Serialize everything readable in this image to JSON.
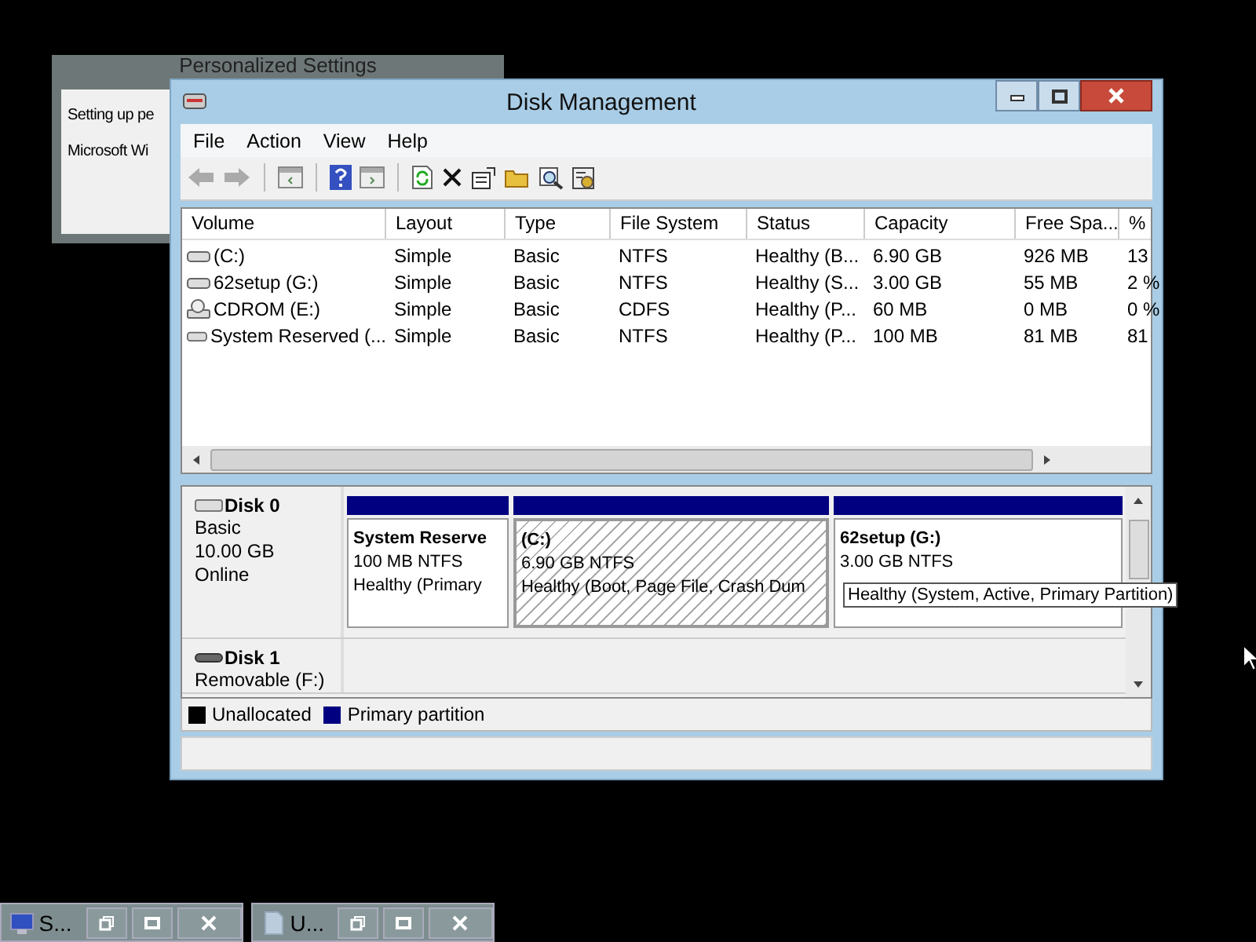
{
  "back_window": {
    "title": "Personalized Settings",
    "lines": [
      "Setting up pe",
      "Microsoft Wi"
    ]
  },
  "window": {
    "title": "Disk Management"
  },
  "menu": [
    "File",
    "Action",
    "View",
    "Help"
  ],
  "volumes": {
    "columns": [
      "Volume",
      "Layout",
      "Type",
      "File System",
      "Status",
      "Capacity",
      "Free Spa...",
      "%"
    ],
    "rows": [
      {
        "kind": "drive",
        "cells": [
          "(C:)",
          "Simple",
          "Basic",
          "NTFS",
          "Healthy (B...",
          "6.90 GB",
          "926 MB",
          "13"
        ]
      },
      {
        "kind": "drive",
        "cells": [
          "62setup (G:)",
          "Simple",
          "Basic",
          "NTFS",
          "Healthy (S...",
          "3.00 GB",
          "55 MB",
          "2 %"
        ]
      },
      {
        "kind": "cdrom",
        "cells": [
          "CDROM (E:)",
          "Simple",
          "Basic",
          "CDFS",
          "Healthy (P...",
          "60 MB",
          "0 MB",
          "0 %"
        ]
      },
      {
        "kind": "drive",
        "cells": [
          "System Reserved (...",
          "Simple",
          "Basic",
          "NTFS",
          "Healthy (P...",
          "100 MB",
          "81 MB",
          "81"
        ]
      }
    ]
  },
  "disks": [
    {
      "kind": "fixed",
      "name": "Disk 0",
      "lines": [
        "Basic",
        "10.00 GB",
        "Online"
      ],
      "partitions": [
        {
          "name": "System Reserve",
          "size": "100 MB NTFS",
          "status": "Healthy (Primary",
          "selected": false
        },
        {
          "name": "(C:)",
          "size": "6.90 GB NTFS",
          "status": "Healthy (Boot, Page File, Crash Dum",
          "selected": true
        },
        {
          "name": "62setup  (G:)",
          "size": "3.00 GB NTFS",
          "selected": false
        }
      ]
    },
    {
      "kind": "removable",
      "name": "Disk 1",
      "lines": [
        "Removable (F:)"
      ]
    }
  ],
  "tooltip": "Healthy (System, Active, Primary Partition)",
  "legend": [
    {
      "label": "Unallocated",
      "color": "#000000"
    },
    {
      "label": "Primary partition",
      "color": "#000080"
    }
  ],
  "taskbar": [
    {
      "label": "S...",
      "kind": "monitor"
    },
    {
      "label": "U...",
      "kind": "file"
    }
  ]
}
